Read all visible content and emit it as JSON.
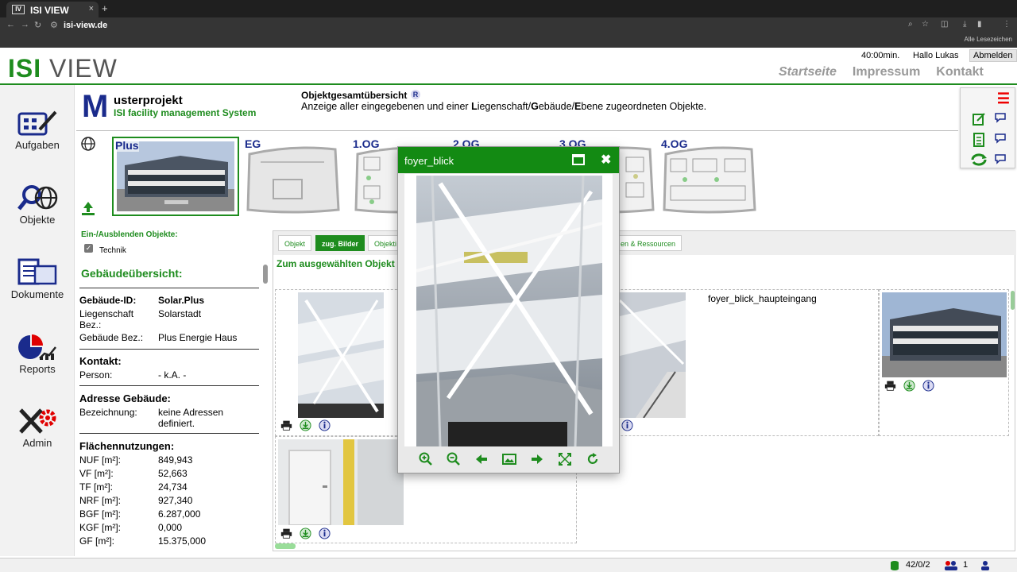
{
  "browser": {
    "tab_title": "ISI VIEW",
    "tab_close": "×",
    "new_tab": "+",
    "url": "isi-view.de",
    "bookmarks_label": "Alle Lesezeichen"
  },
  "header": {
    "logo_isi": "ISI",
    "logo_view": "VIEW",
    "timer": "40:00min.",
    "greeting": "Hallo Lukas",
    "logout_label": "Abmelden",
    "nav": [
      "Startseite",
      "Impressum",
      "Kontakt"
    ]
  },
  "sidebar": {
    "items": [
      {
        "label": "Aufgaben",
        "icon": "tasks-icon"
      },
      {
        "label": "Objekte",
        "icon": "objects-search-icon"
      },
      {
        "label": "Dokumente",
        "icon": "documents-icon"
      },
      {
        "label": "Reports",
        "icon": "reports-chart-icon"
      },
      {
        "label": "Admin",
        "icon": "admin-tools-icon"
      }
    ]
  },
  "project": {
    "initial": "M",
    "name": "usterprojekt",
    "subtitle": "ISI   facility management System",
    "overview_title": "Objektgesamtübersicht",
    "overview_badge": "R",
    "overview_desc_prefix": "Anzeige aller eingegebenen und einer ",
    "overview_desc_L": "L",
    "overview_desc_mid1": "iegenschaft/",
    "overview_desc_G": "G",
    "overview_desc_mid2": "ebäude/",
    "overview_desc_E": "E",
    "overview_desc_suffix": "bene zugeordneten Objekte."
  },
  "floors": [
    "Plus",
    "EG",
    "1.OG",
    "2.OG",
    "3.OG",
    "4.OG"
  ],
  "filter": {
    "title": "Ein-/Ausblenden Objekte:",
    "checkbox_label": "Technik",
    "checked": true
  },
  "building": {
    "title": "Gebäudeübersicht:",
    "id_key": "Gebäude-ID:",
    "id_val": "Solar.Plus",
    "estate_key": "Liegenschaft Bez.:",
    "estate_val": "Solarstadt",
    "bez_key": "Gebäude Bez.:",
    "bez_val": "Plus Energie Haus",
    "contact_head": "Kontakt:",
    "person_key": "Person:",
    "person_val": "- k.A. -",
    "address_head": "Adresse Gebäude:",
    "desc_key": "Bezeichnung:",
    "desc_val": "keine Adressen definiert.",
    "areas_head": "Flächennutzungen:",
    "areas": [
      {
        "k": "NUF [m²]:",
        "v": "849,943"
      },
      {
        "k": "VF [m²]:",
        "v": "52,663"
      },
      {
        "k": "TF [m²]:",
        "v": "24,734"
      },
      {
        "k": "NRF [m²]:",
        "v": "927,340"
      },
      {
        "k": "BGF [m²]:",
        "v": "6.287,000"
      },
      {
        "k": "KGF [m²]:",
        "v": "0,000"
      },
      {
        "k": "GF [m²]:",
        "v": "15.375,000"
      }
    ]
  },
  "content": {
    "tabs": [
      "Objekt",
      "zug. Bilder",
      "Objekti",
      "en & Ressourcen"
    ],
    "active_tab": 1,
    "note": "Zum ausgewählten Objekt (",
    "picture_name": "foyer_blick_haupteingang"
  },
  "modal": {
    "title": "foyer_blick",
    "close": "✖"
  },
  "status": {
    "counter": "42/0/2",
    "users": "1"
  },
  "colors": {
    "brand_green": "#1e8c1e",
    "brand_blue": "#1a2b8c",
    "alert_red": "#e00000"
  }
}
